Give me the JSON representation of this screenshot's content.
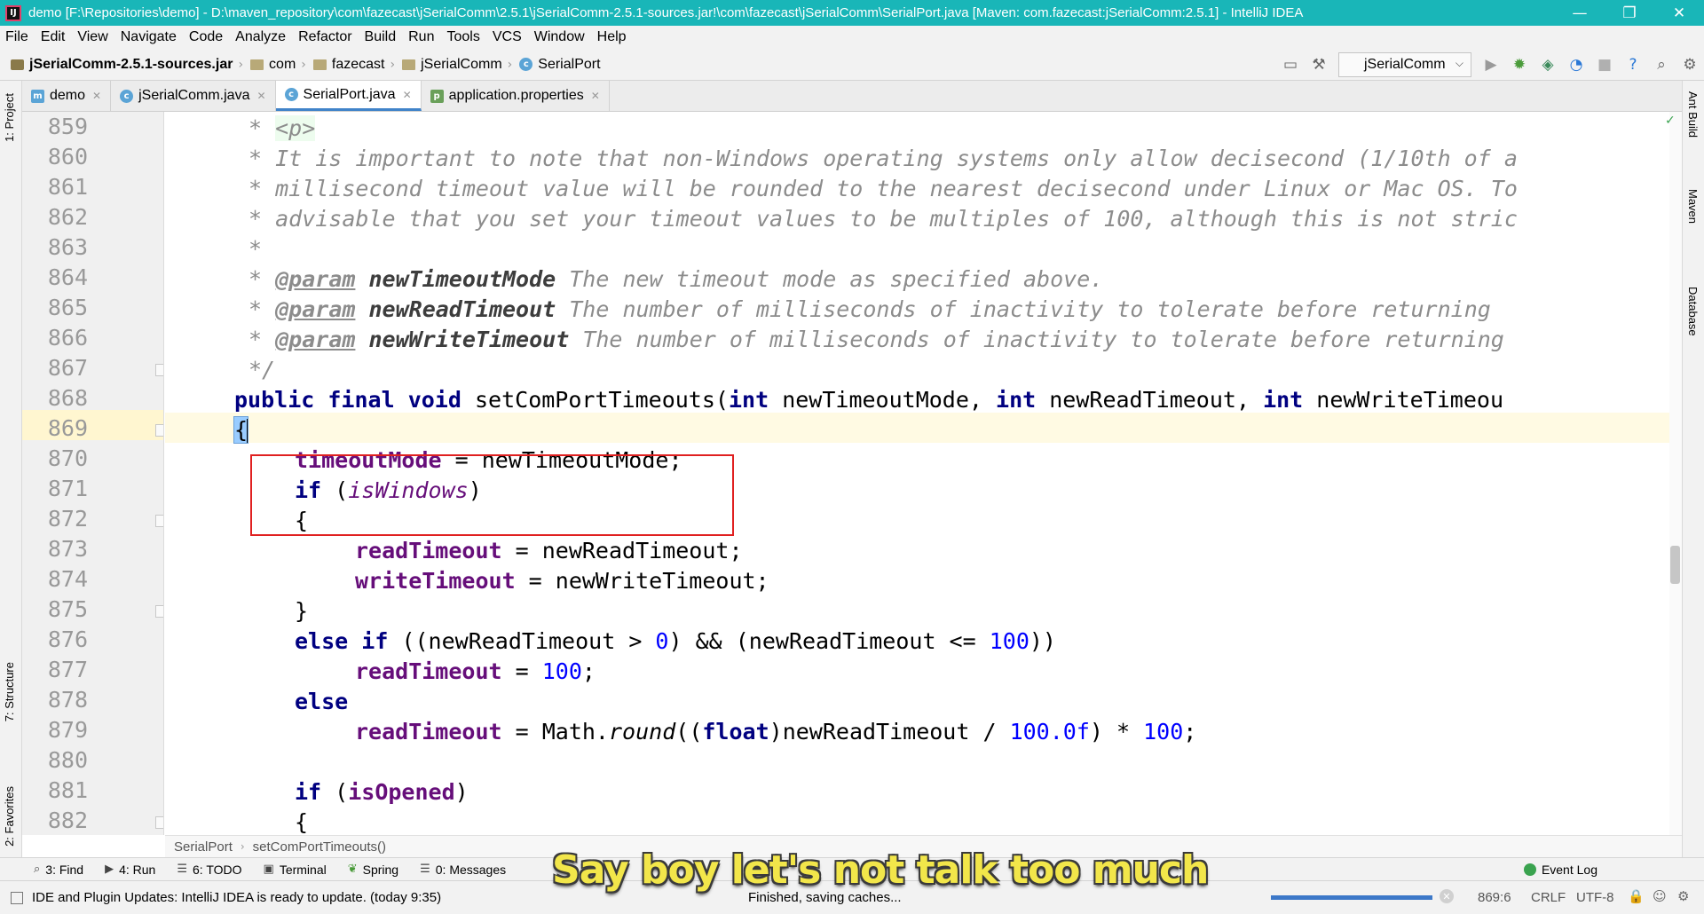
{
  "window": {
    "title": "demo [F:\\Repositories\\demo] - D:\\maven_repository\\com\\fazecast\\jSerialComm\\2.5.1\\jSerialComm-2.5.1-sources.jar!\\com\\fazecast\\jSerialComm\\SerialPort.java [Maven: com.fazecast:jSerialComm:2.5.1] - IntelliJ IDEA",
    "icon": "IJ",
    "minimize": "—",
    "maximize": "❐",
    "close": "✕"
  },
  "menu": [
    "File",
    "Edit",
    "View",
    "Navigate",
    "Code",
    "Analyze",
    "Refactor",
    "Build",
    "Run",
    "Tools",
    "VCS",
    "Window",
    "Help"
  ],
  "breadcrumb": {
    "items": [
      "jSerialComm-2.5.1-sources.jar",
      "com",
      "fazecast",
      "jSerialComm",
      "SerialPort"
    ]
  },
  "run_config": {
    "label": "jSerialComm",
    "chevron": "⌵"
  },
  "left_tabs": {
    "project": "1: Project",
    "structure": "7: Structure",
    "favorites": "2: Favorites"
  },
  "right_tabs": {
    "ant": "Ant Build",
    "maven": "Maven",
    "database": "Database"
  },
  "tabs": [
    {
      "label": "demo",
      "icon": "m"
    },
    {
      "label": "jSerialComm.java",
      "icon": "c"
    },
    {
      "label": "SerialPort.java",
      "icon": "c"
    },
    {
      "label": "application.properties",
      "icon": "p"
    }
  ],
  "editor": {
    "line_numbers": [
      "859",
      "860",
      "861",
      "862",
      "863",
      "864",
      "865",
      "866",
      "867",
      "868",
      "869",
      "870",
      "871",
      "872",
      "873",
      "874",
      "875",
      "876",
      "877",
      "878",
      "879",
      "880",
      "881",
      "882"
    ],
    "code": {
      "l859_star": "* ",
      "l859_tag": "<p>",
      "l860": "* It is important to note that non-Windows operating systems only allow decisecond (1/10th of a",
      "l861": "* millisecond timeout value will be rounded to the nearest decisecond under Linux or Mac OS. To",
      "l862": "* advisable that you set your timeout values to be multiples of 100, although this is not stric",
      "l863": "*",
      "param_tag": "@param",
      "l864_name": "newTimeoutMode",
      "l864_desc": " The new timeout mode as specified above.",
      "l865_name": "newReadTimeout",
      "l865_desc": " The number of milliseconds of inactivity to tolerate before returning",
      "l866_name": "newWriteTimeout",
      "l866_desc": " The number of milliseconds of inactivity to tolerate before returning",
      "l867": "*/",
      "kw_public": "public",
      "kw_final": "final",
      "kw_void": "void",
      "kw_int": "int",
      "kw_if": "if",
      "kw_else": "else",
      "kw_float": "float",
      "method_name": "setComPortTimeouts(",
      "p1": "newTimeoutMode, ",
      "p2": "newReadTimeout, ",
      "p3": "newWriteTimeou",
      "open_brace": "{",
      "close_brace": "}",
      "f_timeoutMode": "timeoutMode",
      "l870_rest": " = newTimeoutMode;",
      "s_isWindows": "isWindows",
      "paren_open": " (",
      "paren_close": ")",
      "f_readTimeout": "readTimeout",
      "l873_rest": " = newReadTimeout;",
      "f_writeTimeout": "writeTimeout",
      "l874_rest": " = newWriteTimeout;",
      "l876_a": " ((newReadTimeout > ",
      "n0": "0",
      "l876_b": ") && (newReadTimeout <= ",
      "n100": "100",
      "l876_c": "))",
      "assign": " = ",
      "semi": ";",
      "l879_a": " = Math.",
      "l879_round": "round",
      "l879_b": "((",
      "l879_c": ")newReadTimeout / ",
      "n100f": "100.0f",
      "l879_d": ") * ",
      "l879_e": ";",
      "f_isOpened": "isOpened"
    },
    "check_mark": "✓"
  },
  "editor_breadcrumb": [
    "SerialPort",
    "setComPortTimeouts()"
  ],
  "tool_windows": [
    {
      "label": "3: Find",
      "icon": "🔍"
    },
    {
      "label": "4: Run",
      "icon": "▶"
    },
    {
      "label": "6: TODO",
      "icon": "☰"
    },
    {
      "label": "Terminal",
      "icon": "▣"
    },
    {
      "label": "Spring",
      "icon": "❦"
    },
    {
      "label": "0: Messages",
      "icon": "☰"
    }
  ],
  "event_log": "Event Log",
  "status": {
    "message": "IDE and Plugin Updates: IntelliJ IDEA is ready to update. (today 9:35)",
    "task": "Finished, saving caches...",
    "progress": 1.0,
    "position": "869:6",
    "line_sep": "CRLF",
    "encoding": "UTF-8"
  },
  "subtitle": "Say boy let's not talk too much",
  "colors": {
    "title_bar": "#19b6b8",
    "keyword": "#000080",
    "field": "#660e7a",
    "number": "#0000ff",
    "highlight_box": "#e02020"
  }
}
